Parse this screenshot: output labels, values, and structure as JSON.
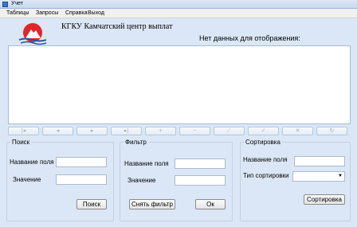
{
  "window": {
    "title": "Учет"
  },
  "menu": {
    "items": [
      "Таблицы",
      "Запросы",
      "Справка",
      "Выход"
    ]
  },
  "header": {
    "org_title": "КГКУ Камчатский центр выплат",
    "no_data_text": "Нет данных для отображения:"
  },
  "navigator": {
    "buttons": [
      "first",
      "prior",
      "next",
      "last",
      "insert",
      "delete",
      "edit",
      "post",
      "cancel",
      "refresh"
    ]
  },
  "search": {
    "title": "Поиск",
    "field_label": "Название поля",
    "value_label": "Значение",
    "field_value": "",
    "value_value": "",
    "search_button": "Поиск"
  },
  "filter": {
    "title": "Фильтр",
    "field_label": "Название поля",
    "value_label": "Значение",
    "field_value": "",
    "value_value": "",
    "clear_button": "Снять фильтр",
    "ok_button": "Ок"
  },
  "sort": {
    "title": "Сортировка",
    "field_label": "Название поля",
    "type_label": "Тип сортировки",
    "field_value": "",
    "type_value": "",
    "sort_button": "Сортировка"
  },
  "colors": {
    "client_bg": "#dbe7f6",
    "logo_red": "#e0262b",
    "logo_blue": "#2356a8"
  }
}
